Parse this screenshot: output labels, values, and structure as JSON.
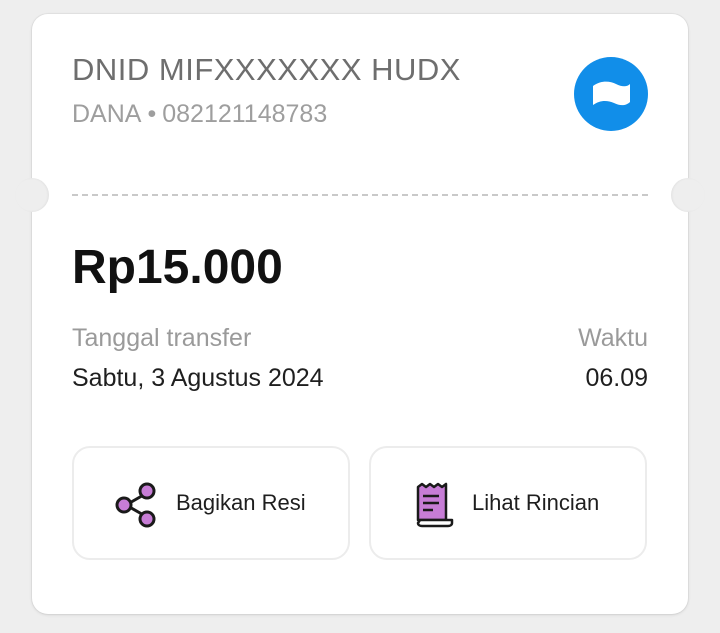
{
  "receipt": {
    "recipient_name": "DNID MIFXXXXXXX HUDX",
    "provider": "DANA",
    "separator": "•",
    "account_number": "082121148783",
    "amount": "Rp15.000",
    "date_label": "Tanggal transfer",
    "date_value": "Sabtu, 3 Agustus 2024",
    "time_label": "Waktu",
    "time_value": "06.09"
  },
  "actions": {
    "share_label": "Bagikan Resi",
    "detail_label": "Lihat Rincian"
  },
  "icons": {
    "provider_logo": "dana-logo-icon",
    "share": "share-icon",
    "receipt": "receipt-icon"
  },
  "colors": {
    "brand_blue": "#118ee9",
    "icon_purple": "#c77dd6",
    "icon_outline": "#1a1a1a"
  }
}
